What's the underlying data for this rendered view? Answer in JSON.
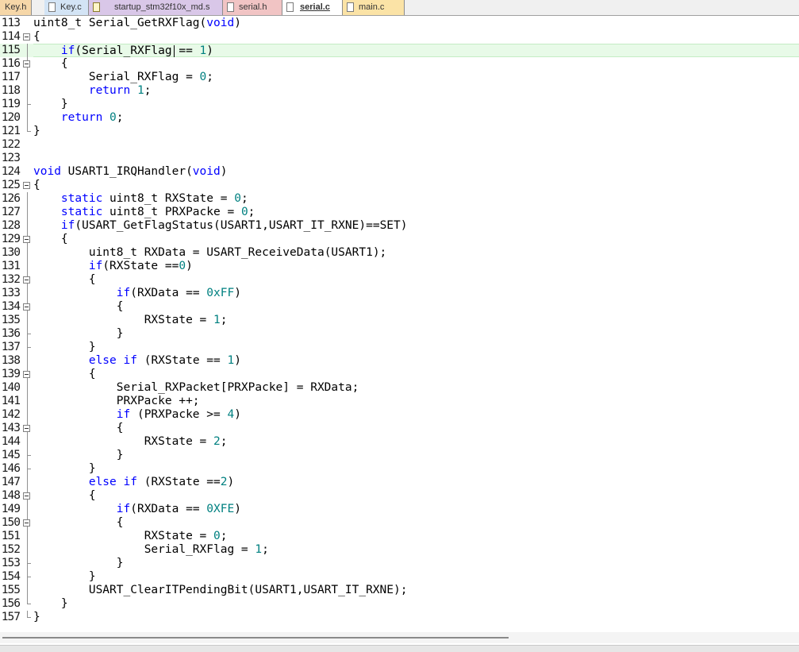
{
  "tabs": [
    {
      "label": "Key.h",
      "color": "#f6d7a8",
      "icon": "h-file-icon",
      "active": false
    },
    {
      "label": "Key.c",
      "color": "#d3e4f5",
      "icon": "c-file-icon",
      "active": false
    },
    {
      "label": "startup_stm32f10x_md.s",
      "color": "#d9c7e8",
      "icon": "asm-file-icon",
      "active": false
    },
    {
      "label": "serial.h",
      "color": "#f1c4c4",
      "icon": "h-file-icon",
      "active": false
    },
    {
      "label": "serial.c",
      "color": "#ffffff",
      "icon": "c-file-icon",
      "active": true
    },
    {
      "label": "main.c",
      "color": "#fbe3a6",
      "icon": "c-file-icon",
      "active": false
    }
  ],
  "editor": {
    "current_line": 115,
    "lines": [
      {
        "n": "113",
        "text": "uint8_t Serial_GetRXFlag(void)"
      },
      {
        "n": "114",
        "text": "{"
      },
      {
        "n": "115",
        "text": "    if(Serial_RXFlag == 1)"
      },
      {
        "n": "116",
        "text": "    {"
      },
      {
        "n": "117",
        "text": "        Serial_RXFlag = 0;"
      },
      {
        "n": "118",
        "text": "        return 1;"
      },
      {
        "n": "119",
        "text": "    }"
      },
      {
        "n": "120",
        "text": "    return 0;"
      },
      {
        "n": "121",
        "text": "}"
      },
      {
        "n": "122",
        "text": ""
      },
      {
        "n": "123",
        "text": ""
      },
      {
        "n": "124",
        "text": "void USART1_IRQHandler(void)"
      },
      {
        "n": "125",
        "text": "{"
      },
      {
        "n": "126",
        "text": "    static uint8_t RXState = 0;"
      },
      {
        "n": "127",
        "text": "    static uint8_t PRXPacke = 0;"
      },
      {
        "n": "128",
        "text": "    if(USART_GetFlagStatus(USART1,USART_IT_RXNE)==SET)"
      },
      {
        "n": "129",
        "text": "    {"
      },
      {
        "n": "130",
        "text": "        uint8_t RXData = USART_ReceiveData(USART1);"
      },
      {
        "n": "131",
        "text": "        if(RXState ==0)"
      },
      {
        "n": "132",
        "text": "        {"
      },
      {
        "n": "133",
        "text": "            if(RXData == 0xFF)"
      },
      {
        "n": "134",
        "text": "            {"
      },
      {
        "n": "135",
        "text": "                RXState = 1;"
      },
      {
        "n": "136",
        "text": "            }"
      },
      {
        "n": "137",
        "text": "        }"
      },
      {
        "n": "138",
        "text": "        else if (RXState == 1)"
      },
      {
        "n": "139",
        "text": "        {"
      },
      {
        "n": "140",
        "text": "            Serial_RXPacket[PRXPacke] = RXData;"
      },
      {
        "n": "141",
        "text": "            PRXPacke ++;"
      },
      {
        "n": "142",
        "text": "            if (PRXPacke >= 4)"
      },
      {
        "n": "143",
        "text": "            {"
      },
      {
        "n": "144",
        "text": "                RXState = 2;"
      },
      {
        "n": "145",
        "text": "            }"
      },
      {
        "n": "146",
        "text": "        }"
      },
      {
        "n": "147",
        "text": "        else if (RXState ==2)"
      },
      {
        "n": "148",
        "text": "        {"
      },
      {
        "n": "149",
        "text": "            if(RXData == 0XFE)"
      },
      {
        "n": "150",
        "text": "            {"
      },
      {
        "n": "151",
        "text": "                RXState = 0;"
      },
      {
        "n": "152",
        "text": "                Serial_RXFlag = 1;"
      },
      {
        "n": "153",
        "text": "            }"
      },
      {
        "n": "154",
        "text": "        }"
      },
      {
        "n": "155",
        "text": "        USART_ClearITPendingBit(USART1,USART_IT_RXNE);"
      },
      {
        "n": "156",
        "text": "    }"
      },
      {
        "n": "157",
        "text": "}"
      }
    ]
  },
  "colors": {
    "keyword": "#0000ff",
    "number": "#008080",
    "current_line_bg": "#e8fae8"
  }
}
